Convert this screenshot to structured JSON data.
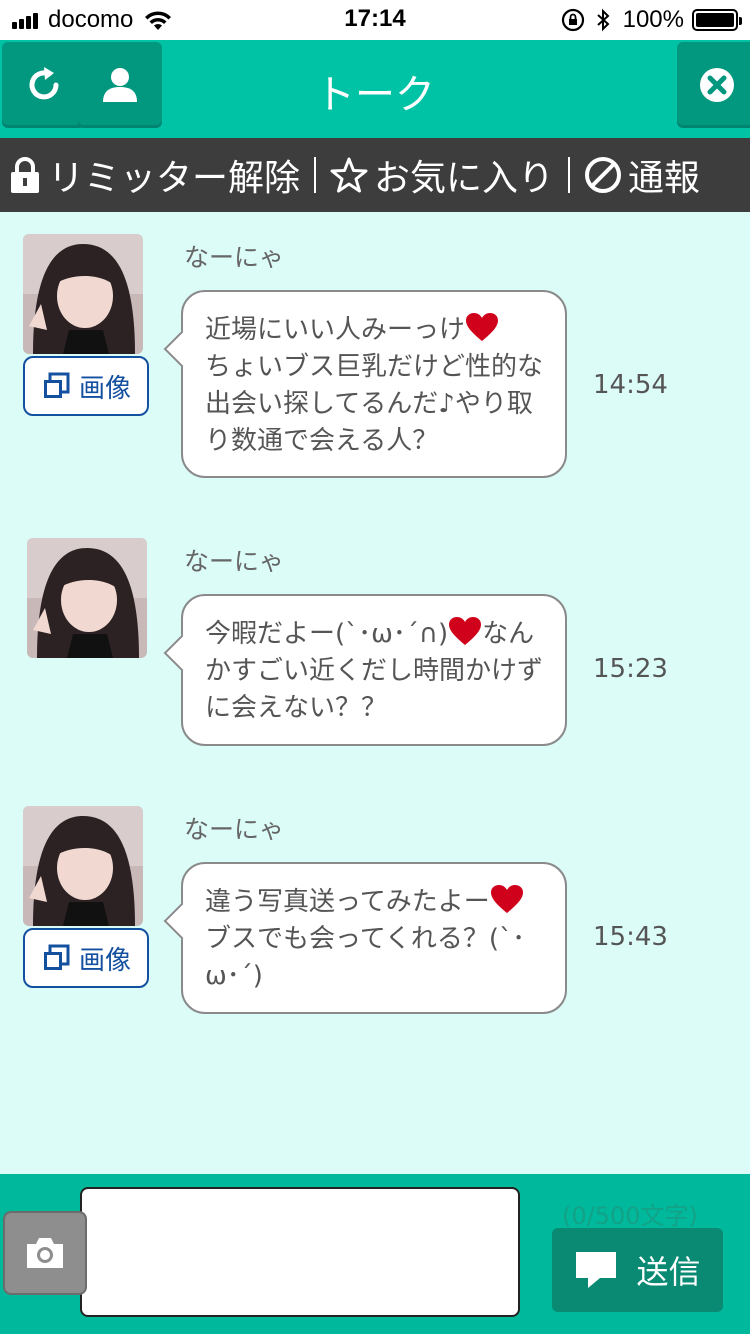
{
  "status_bar": {
    "carrier": "docomo",
    "time": "17:14",
    "battery_pct": "100%",
    "icons": [
      "signal-icon",
      "wifi-icon",
      "rotation-lock-icon",
      "bluetooth-icon",
      "battery-icon"
    ]
  },
  "header": {
    "title": "トーク",
    "left_buttons": [
      "refresh-icon",
      "profile-icon"
    ],
    "right_button": "close-icon"
  },
  "actions": {
    "unlock_label": "リミッター解除",
    "favorite_label": "お気に入り",
    "report_label": "通報"
  },
  "messages": [
    {
      "sender": "なーにゃ",
      "text_before": "近場にいい人みーっけ",
      "text_after": "\nちょいブス巨乳だけど性的な出会い探してるんだ♪やり取り数通で会える人？",
      "time": "14:54",
      "has_image_button": true,
      "image_button_label": "画像"
    },
    {
      "sender": "なーにゃ",
      "text_before": "今暇だよー(`･ω･´∩)",
      "text_after": "なんかすごい近くだし時間かけずに会えない？？",
      "time": "15:23",
      "has_image_button": false
    },
    {
      "sender": "なーにゃ",
      "text_before": "違う写真送ってみたよー",
      "text_after": "\nブスでも会ってくれる？(`･ω･´)",
      "time": "15:43",
      "has_image_button": true,
      "image_button_label": "画像"
    }
  ],
  "input": {
    "value": "",
    "counter": "(0/500文字)",
    "send_label": "送信"
  },
  "colors": {
    "header": "#00c3a6",
    "header_button": "#02977f",
    "action_bar": "#3d3d3d",
    "chat_background": "#dcfcf8",
    "input_bar": "#00b89b",
    "send_button": "#0a8a73",
    "heart": "#d0021b",
    "image_button_border": "#1450a0"
  }
}
